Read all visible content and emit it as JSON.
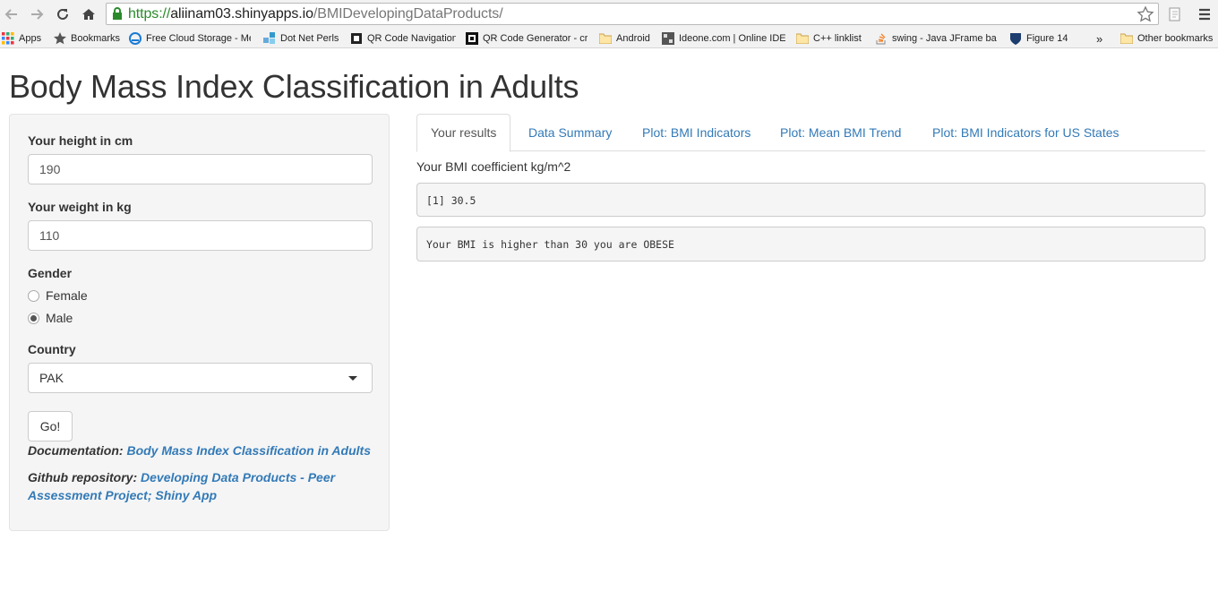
{
  "browser": {
    "url": {
      "scheme": "https://",
      "host": "aliinam03.shinyapps.io",
      "path": "/BMIDevelopingDataProducts/"
    },
    "bookmarks": [
      {
        "label": "Apps",
        "icon": "apps-grid-icon"
      },
      {
        "label": "Bookmarks",
        "icon": "star-icon"
      },
      {
        "label": "Free Cloud Storage - Me",
        "icon": "cloud-icon"
      },
      {
        "label": "Dot Net Perls",
        "icon": "dotnet-icon"
      },
      {
        "label": "QR Code Navigation",
        "icon": "qr-icon"
      },
      {
        "label": "QR Code Generator - cre",
        "icon": "qr-generator-icon"
      },
      {
        "label": "Android",
        "icon": "folder-icon"
      },
      {
        "label": "Ideone.com | Online IDE",
        "icon": "ideone-icon"
      },
      {
        "label": "C++ linklist",
        "icon": "folder-icon"
      },
      {
        "label": "swing - Java JFrame bac",
        "icon": "stackoverflow-icon"
      },
      {
        "label": "Figure 14",
        "icon": "shield-icon"
      },
      {
        "label": "Other bookmarks",
        "icon": "folder-icon"
      }
    ],
    "overflow_label": "»"
  },
  "page": {
    "title": "Body Mass Index Classification in Adults"
  },
  "sidebar": {
    "height_label": "Your height in cm",
    "height_value": "190",
    "weight_label": "Your weight in kg",
    "weight_value": "110",
    "gender_label": "Gender",
    "gender_options": [
      {
        "label": "Female",
        "checked": false
      },
      {
        "label": "Male",
        "checked": true
      }
    ],
    "country_label": "Country",
    "country_value": "PAK",
    "go_label": "Go!",
    "doc_prefix": "Documentation:",
    "doc_link": "Body Mass Index Classification in Adults",
    "github_prefix": "Github repository:",
    "github_link": "Developing Data Products - Peer Assessment Project; Shiny App"
  },
  "tabs": [
    {
      "label": "Your results",
      "active": true
    },
    {
      "label": "Data Summary",
      "active": false
    },
    {
      "label": "Plot: BMI Indicators",
      "active": false
    },
    {
      "label": "Plot: Mean BMI Trend",
      "active": false
    },
    {
      "label": "Plot: BMI Indicators for US States",
      "active": false
    }
  ],
  "results": {
    "label": "Your BMI coefficient kg/m^2",
    "bmi_output": "[1] 30.5",
    "classification_output": "Your BMI is higher than 30 you are OBESE"
  },
  "colors": {
    "link": "#337ab7",
    "secure_scheme": "#2a8a2a"
  }
}
